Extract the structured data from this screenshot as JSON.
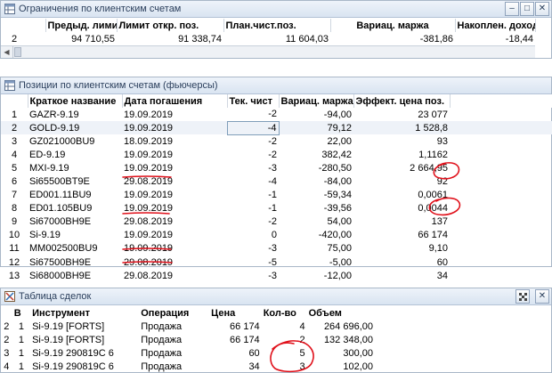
{
  "limits_window": {
    "title": "Ограничения по клиентским счетам",
    "buttons": {
      "minimize": "–",
      "maximize": "□",
      "close": "✕"
    },
    "columns": [
      "Предыд. лимит откј",
      "Лимит откр. поз.",
      "План.чист.поз.",
      "Вариац. маржа",
      "Накоплен. доход"
    ],
    "rows": [
      {
        "n": "2",
        "prev": "94 710,55",
        "limit": "91 338,74",
        "plan": "11 604,03",
        "varm": "-381,86",
        "accum": "-18,44"
      }
    ]
  },
  "positions_window": {
    "title": "Позиции по клиентским счетам (фьючерсы)",
    "columns": [
      "Краткое название",
      "Дата погашения",
      "Тек. чист",
      "Вариац. маржа",
      "Эффект. цена поз."
    ],
    "rows": [
      {
        "n": "1",
        "name": "GAZR-9.19",
        "date": "19.09.2019",
        "net": "-2",
        "varm": "-94,00",
        "price": "23 077"
      },
      {
        "n": "2",
        "name": "GOLD-9.19",
        "date": "19.09.2019",
        "net": "-4",
        "varm": "79,12",
        "price": "1 528,8"
      },
      {
        "n": "3",
        "name": "GZ021000BU9",
        "date": "18.09.2019",
        "net": "-2",
        "varm": "22,00",
        "price": "93"
      },
      {
        "n": "4",
        "name": "ED-9.19",
        "date": "19.09.2019",
        "net": "-2",
        "varm": "382,42",
        "price": "1,1162"
      },
      {
        "n": "5",
        "name": "MXI-9.19",
        "date": "19.09.2019",
        "net": "-3",
        "varm": "-280,50",
        "price": "2 664,95"
      },
      {
        "n": "6",
        "name": "Si65500BT9E",
        "date": "29.08.2019",
        "net": "-4",
        "varm": "-84,00",
        "price": "92"
      },
      {
        "n": "7",
        "name": "ED001.11BU9",
        "date": "19.09.2019",
        "net": "-1",
        "varm": "-59,34",
        "price": "0,0061"
      },
      {
        "n": "8",
        "name": "ED01.105BU9",
        "date": "19.09.2019",
        "net": "-1",
        "varm": "-39,56",
        "price": "0,0044"
      },
      {
        "n": "9",
        "name": "Si67000BH9E",
        "date": "29.08.2019",
        "net": "-2",
        "varm": "54,00",
        "price": "137"
      },
      {
        "n": "10",
        "name": "Si-9.19",
        "date": "19.09.2019",
        "net": "0",
        "varm": "-420,00",
        "price": "66 174"
      },
      {
        "n": "11",
        "name": "MM002500BU9",
        "date": "19.09.2019",
        "net": "-3",
        "varm": "75,00",
        "price": "9,10"
      },
      {
        "n": "12",
        "name": "Si67500BH9E",
        "date": "29.08.2019",
        "net": "-5",
        "varm": "-5,00",
        "price": "60"
      },
      {
        "n": "13",
        "name": "Si68000BH9E",
        "date": "29.08.2019",
        "net": "-3",
        "varm": "-12,00",
        "price": "34"
      }
    ]
  },
  "deals_window": {
    "title": "Таблица сделок",
    "buttons": {
      "close": "✕"
    },
    "columns": [
      "В",
      "Инструмент",
      "Операция",
      "Цена",
      "Кол-во",
      "Объем"
    ],
    "rows": [
      {
        "n": "2",
        "b": "1",
        "instr": "Si-9.19 [FORTS]",
        "op": "Продажа",
        "price": "66 174",
        "qty": "4",
        "vol": "264 696,00"
      },
      {
        "n": "2",
        "b": "1",
        "instr": "Si-9.19 [FORTS]",
        "op": "Продажа",
        "price": "66 174",
        "qty": "2",
        "vol": "132 348,00"
      },
      {
        "n": "3",
        "b": "1",
        "instr": "Si-9.19   290819C 6",
        "op": "Продажа",
        "price": "60",
        "qty": "5",
        "vol": "300,00"
      },
      {
        "n": "4",
        "b": "1",
        "instr": "Si-9.19   290819C 6",
        "op": "Продажа",
        "price": "34",
        "qty": "3",
        "vol": "102,00"
      }
    ]
  },
  "icons": {
    "table": "table-grid-icon",
    "settings": "tools-icon"
  },
  "colors": {
    "annotation": "#e0101a",
    "titlebar_text": "#2b3f5c"
  }
}
